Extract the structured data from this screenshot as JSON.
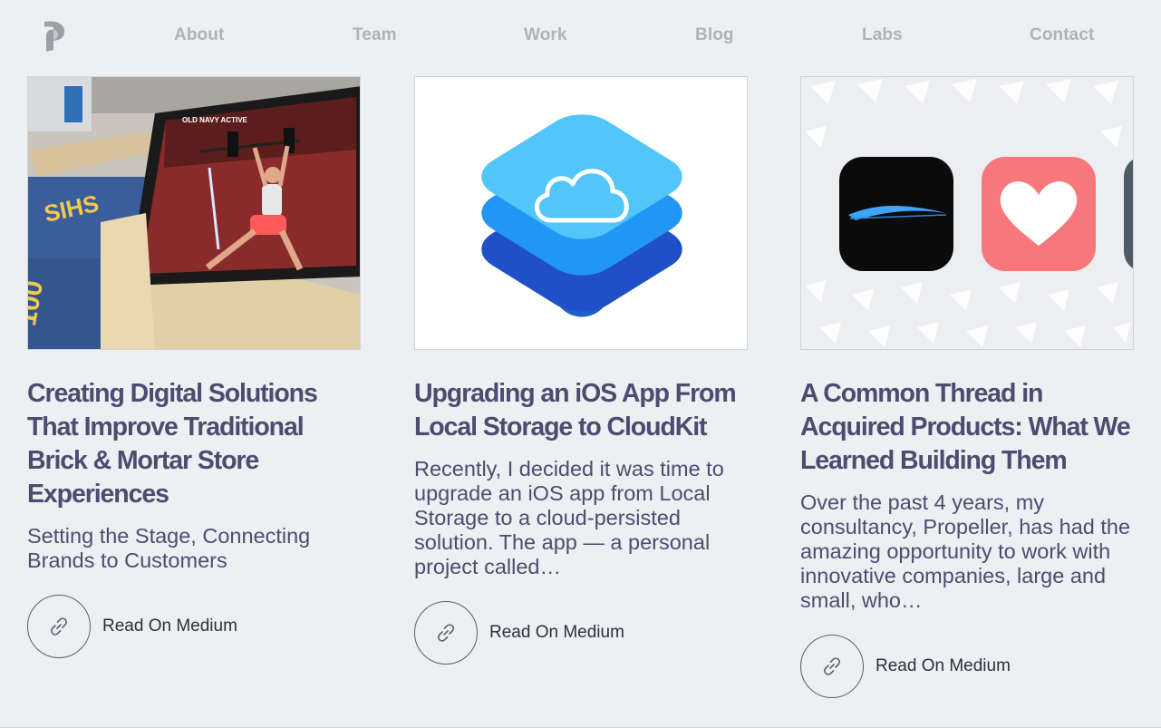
{
  "nav": {
    "logo": "propeller-logo-icon",
    "links": [
      "About",
      "Team",
      "Work",
      "Blog",
      "Labs",
      "Contact"
    ]
  },
  "cards": [
    {
      "image": "store-display-photo",
      "title": "Creating Digital Solutions That Improve Traditional Brick & Mortar Store Experiences",
      "excerpt": "Setting the Stage, Connecting Brands to Customers",
      "link_label": "Read On Medium",
      "link_icon": "link-icon",
      "tablet_text": "OLD NAVY ACTIVE"
    },
    {
      "image": "cloudkit-logo",
      "title": "Upgrading an iOS App From Local Storage to CloudKit",
      "excerpt": "Recently, I decided it was time to upgrade an iOS app from Local Storage to a cloud-persisted solution. The app — a personal project called…",
      "link_label": "Read On Medium",
      "link_icon": "link-icon"
    },
    {
      "image": "app-icons-pattern",
      "title": "A Common Thread in Acquired Products: What We Learned Building Them",
      "excerpt": "Over the past 4 years, my consultancy, Propeller, has had the amazing opportunity to work with innovative companies, large and small, who…",
      "link_label": "Read On Medium",
      "link_icon": "link-icon"
    }
  ],
  "colors": {
    "background": "#edf0f2",
    "nav_text": "#aeb3b8",
    "heading": "#4b4d70",
    "cloudkit_top": "#4fc3f7",
    "cloudkit_mid": "#2196f3",
    "cloudkit_bottom": "#1e5fd0",
    "heart_tile": "#f7787a"
  }
}
